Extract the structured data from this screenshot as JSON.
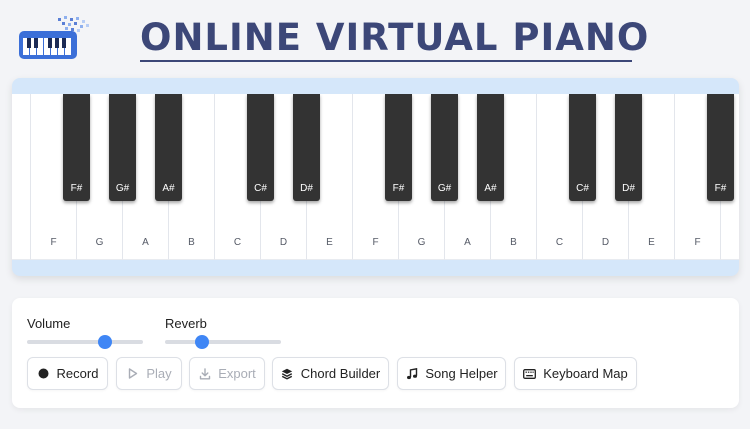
{
  "header": {
    "title": "ONLINE VIRTUAL PIANO",
    "logo_icon": "piano-logo-icon"
  },
  "piano": {
    "white_keys": [
      "",
      "F",
      "G",
      "A",
      "B",
      "C",
      "D",
      "E",
      "F",
      "G",
      "A",
      "B",
      "C",
      "D",
      "E",
      "F",
      ""
    ],
    "black_keys": [
      "F#",
      "G#",
      "A#",
      "C#",
      "D#",
      "F#",
      "G#",
      "A#",
      "C#",
      "D#",
      "F#"
    ]
  },
  "controls": {
    "volume": {
      "label": "Volume",
      "value": 0.67
    },
    "reverb": {
      "label": "Reverb",
      "value": 0.32
    },
    "buttons": {
      "record": {
        "label": "Record",
        "icon": "record-dot-icon",
        "enabled": true
      },
      "play": {
        "label": "Play",
        "icon": "play-icon",
        "enabled": false
      },
      "export": {
        "label": "Export",
        "icon": "download-icon",
        "enabled": false
      },
      "chord_builder": {
        "label": "Chord Builder",
        "icon": "layers-icon",
        "enabled": true
      },
      "song_helper": {
        "label": "Song Helper",
        "icon": "music-note-icon",
        "enabled": true
      },
      "keyboard_map": {
        "label": "Keyboard Map",
        "icon": "keyboard-icon",
        "enabled": true
      }
    }
  },
  "colors": {
    "title": "#3c4778",
    "accent": "#3f86f5",
    "piano_frame": "#d5e7fa",
    "black_key": "#333333"
  }
}
